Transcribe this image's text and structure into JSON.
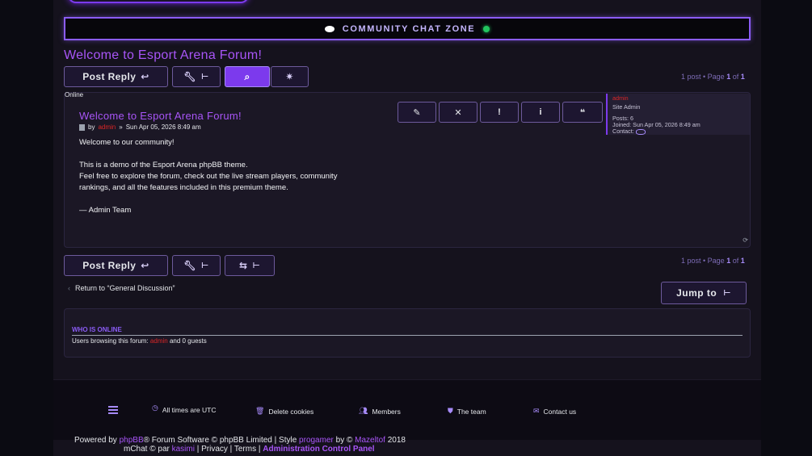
{
  "banner": {
    "title": "COMMUNITY CHAT ZONE"
  },
  "topic": {
    "title": "Welcome to Esport Arena Forum!"
  },
  "toolbar": {
    "post_reply": "Post Reply",
    "pagination_prefix": "1 post • Page ",
    "page_current": "1",
    "page_of": " of ",
    "page_total": "1"
  },
  "online_label": "Online",
  "post": {
    "title": "Welcome to Esport Arena Forum!",
    "by": "by",
    "author": "admin",
    "separator": "»",
    "date": "Sun Apr 05, 2026 8:49 am",
    "body": [
      "Welcome to our community!",
      "This is a demo of the Esport Arena phpBB theme.",
      "Feel free to explore the forum, check out the live stream players, community rankings, and all the features included in this premium theme.",
      "— Admin Team"
    ],
    "profile": {
      "name": "admin",
      "rank": "Site Admin",
      "posts": "Posts: 6",
      "joined": "Joined: Sun Apr 05, 2026 8:49 am",
      "contact": "Contact:"
    }
  },
  "return_link": "Return to “General Discussion”",
  "jump_to": "Jump to",
  "who_online": {
    "title": "WHO IS ONLINE",
    "prefix": "Users browsing this forum: ",
    "user": "admin",
    "suffix": " and 0 guests"
  },
  "footer": {
    "times": "All times are UTC",
    "delete_cookies": "Delete cookies",
    "members": "Members",
    "team": "The team",
    "contact": "Contact us"
  },
  "credits": {
    "powered": "Powered by ",
    "phpbb": "phpBB",
    "software": "® Forum Software © phpBB Limited | Style ",
    "style": "progamer",
    "by": " by © ",
    "author": "Mazeltof",
    "year": " 2018",
    "mchat": "mChat © par ",
    "kasimi": "kasimi",
    "links": " | Privacy | Terms | ",
    "acp": "Administration Control Panel"
  },
  "colors": {
    "accent": "#8b5cf6",
    "author": "#dc2626",
    "live": "#22c55e"
  }
}
